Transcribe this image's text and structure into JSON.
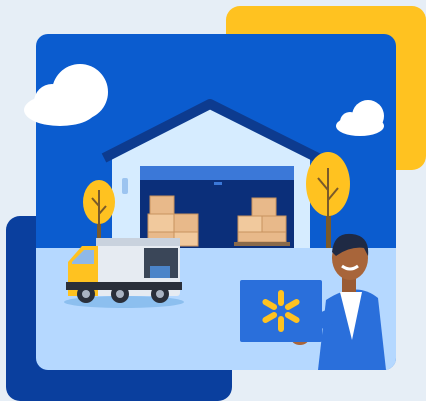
{
  "illustration": {
    "colors": {
      "page_background": "#e6eef6",
      "sky": "#0b5ccf",
      "accent_yellow": "#ffc220",
      "dark_navy": "#0a3f9e",
      "ground": "#b5d8ff",
      "warehouse_wall": "#d6ecff",
      "warehouse_roof": "#0d3b8f",
      "cardboard": "#e8b98a",
      "tree": "#ffc220",
      "truck_cab": "#ffc220",
      "person_shirt": "#2a6fdb"
    },
    "icons": [
      "cloud-icon",
      "tree-icon",
      "truck-icon",
      "box-icon",
      "spark-logo-icon",
      "person-icon"
    ]
  }
}
